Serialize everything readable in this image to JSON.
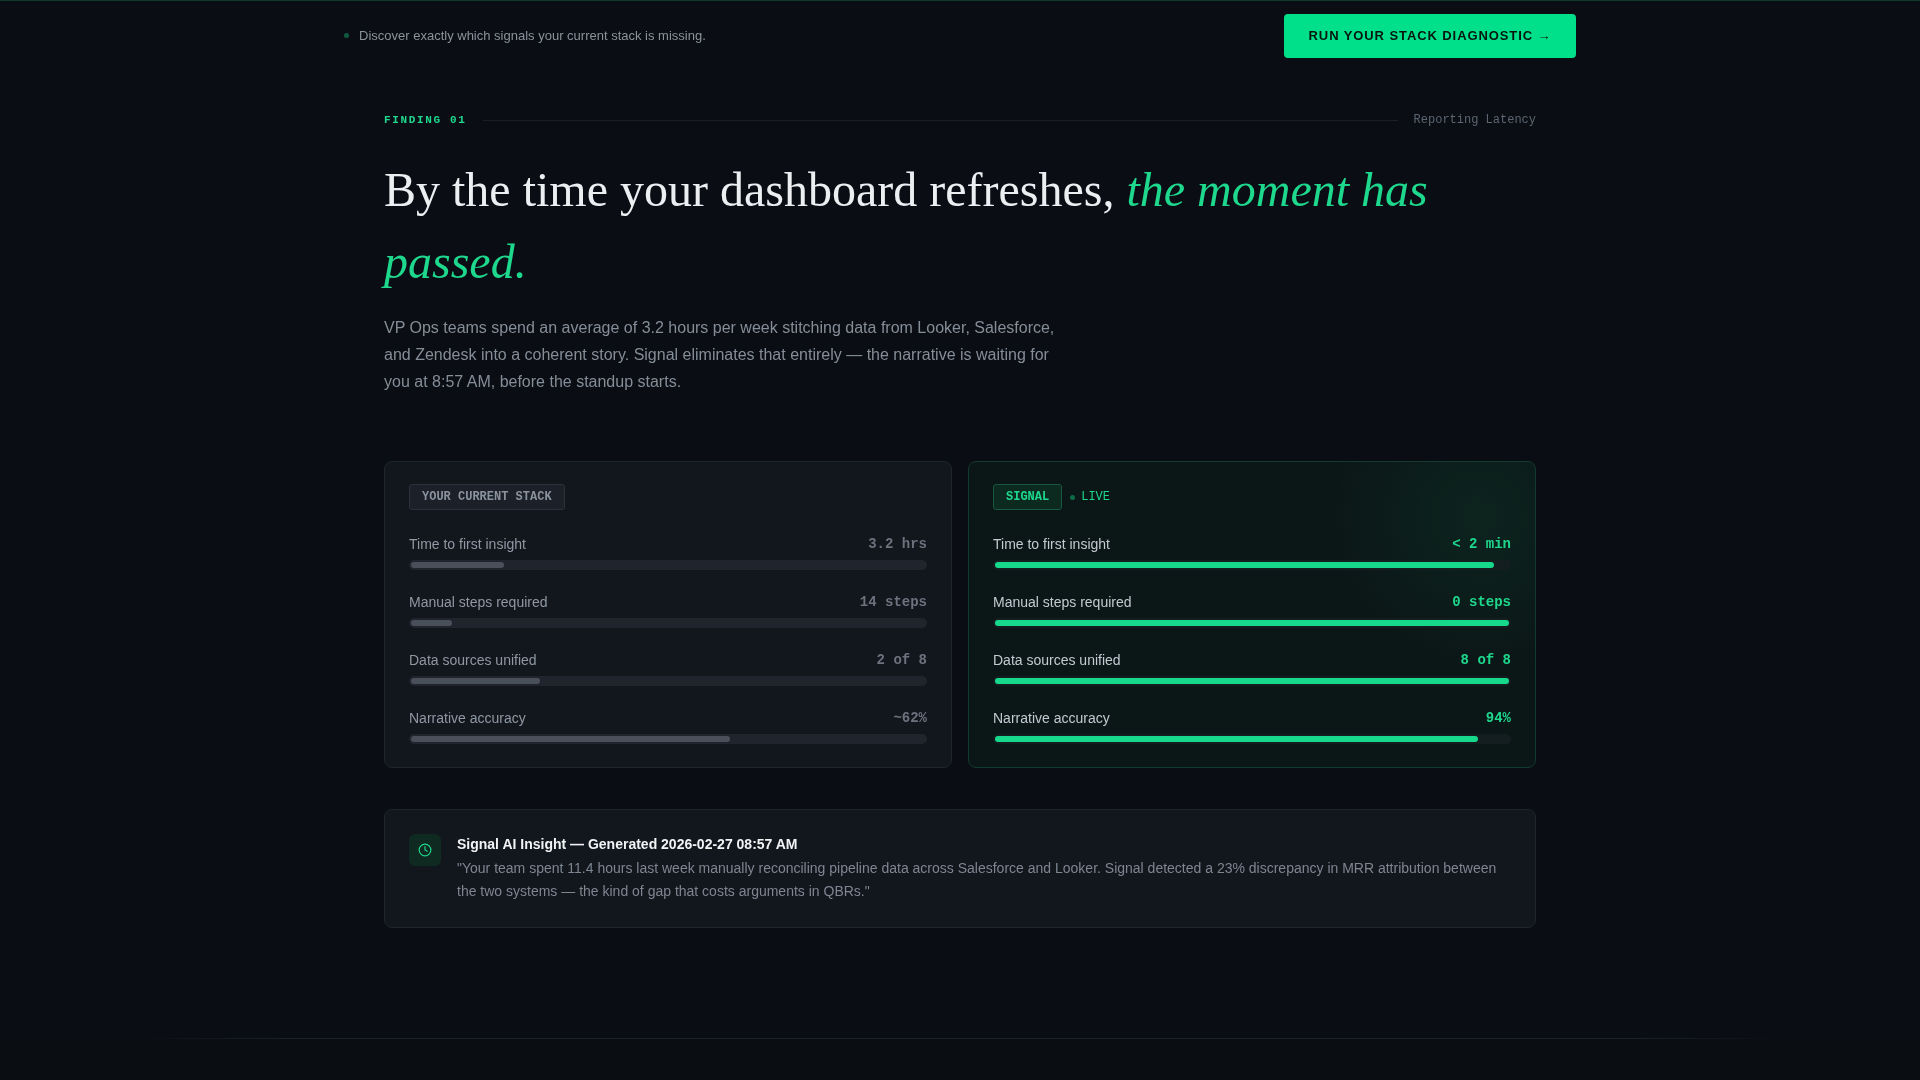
{
  "announcement_bar": {
    "text": "Discover exactly which signals your current stack is missing.",
    "button": "RUN YOUR STACK DIAGNOSTIC →"
  },
  "finding": {
    "label": "FINDING 01",
    "topic": "Reporting Latency",
    "headline": "By the time your dashboard refreshes, *the moment has passed.*",
    "body": "VP Ops teams spend an average of 3.2 hours per week stitching data from Looker, Salesforce, and Zendesk into a coherent story. Signal eliminates that entirely — the narrative is waiting for you at 8:57 AM, before the standup starts."
  },
  "comparison": [
    {
      "kind": "current",
      "badge": "YOUR CURRENT STACK",
      "metrics": [
        {
          "name": "Time to first insight",
          "reading": "3.2 hrs",
          "level": 0.18
        },
        {
          "name": "Manual steps required",
          "reading": "14 steps",
          "level": 0.08
        },
        {
          "name": "Data sources unified",
          "reading": "2 of 8",
          "level": 0.25
        },
        {
          "name": "Narrative accuracy",
          "reading": "~62%",
          "level": 0.62
        }
      ]
    },
    {
      "kind": "signal",
      "badge": "SIGNAL",
      "status": "LIVE",
      "metrics": [
        {
          "name": "Time to first insight",
          "reading": "< 2 min",
          "level": 0.97
        },
        {
          "name": "Manual steps required",
          "reading": "0 steps",
          "level": 1
        },
        {
          "name": "Data sources unified",
          "reading": "8 of 8",
          "level": 1
        },
        {
          "name": "Narrative accuracy",
          "reading": "94%",
          "level": 0.94
        }
      ]
    }
  ],
  "insight": {
    "title": "Signal AI Insight — Generated 2026-02-27 08:57 AM",
    "quote": "\"Your team spent 11.4 hours last week manually reconciling pipeline data across Salesforce and Looker. Signal detected a 23% discrepancy in MRR attribution between the two systems — the kind of gap that costs arguments in QBRs.\""
  }
}
